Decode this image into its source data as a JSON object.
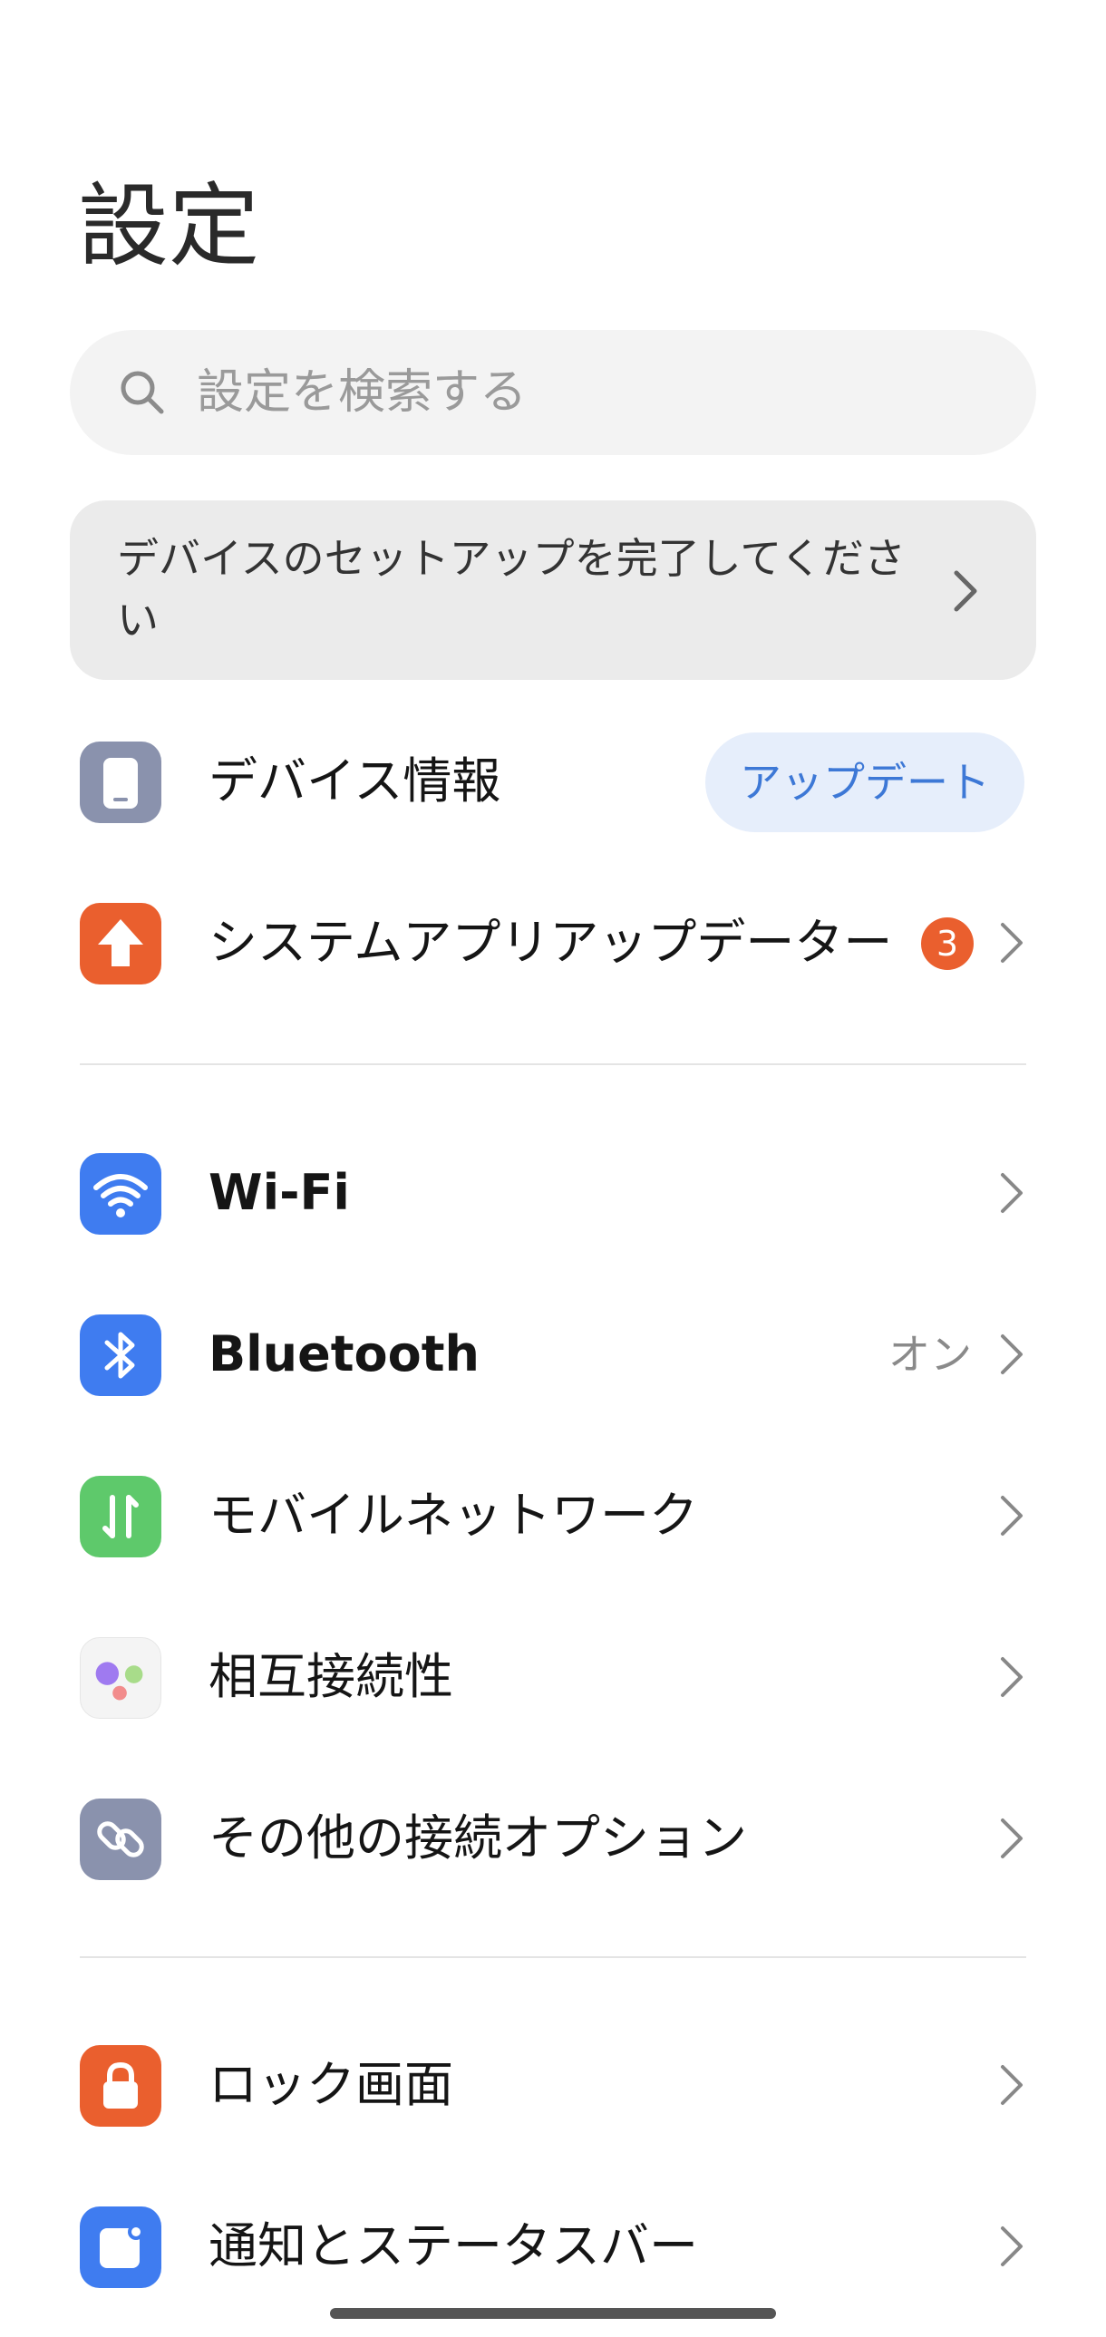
{
  "page": {
    "title": "設定"
  },
  "search": {
    "placeholder": "設定を検索する"
  },
  "banner": {
    "text": "デバイスのセットアップを完了してください"
  },
  "section1": {
    "device_info": {
      "label": "デバイス情報",
      "button": "アップデート",
      "icon": "phone-icon",
      "color": "#8a92ad"
    },
    "system_updater": {
      "label": "システムアプリアップデーター",
      "badge": "3",
      "icon": "arrow-up-icon",
      "color": "#ea5f2e"
    }
  },
  "section2": {
    "wifi": {
      "label": "Wi-Fi",
      "icon": "wifi-icon",
      "color": "#3f7cf0"
    },
    "bluetooth": {
      "label": "Bluetooth",
      "value": "オン",
      "icon": "bluetooth-icon",
      "color": "#3f7cf0"
    },
    "mobile_network": {
      "label": "モバイルネットワーク",
      "icon": "mobile-data-icon",
      "color": "#5ec96b"
    },
    "interconnectivity": {
      "label": "相互接続性",
      "icon": "interconnect-icon"
    },
    "more_connections": {
      "label": "その他の接続オプション",
      "icon": "link-icon",
      "color": "#8a92ad"
    }
  },
  "section3": {
    "lock_screen": {
      "label": "ロック画面",
      "icon": "lock-icon",
      "color": "#ea5f2e"
    },
    "notifications": {
      "label": "通知とステータスバー",
      "icon": "notification-icon",
      "color": "#3f7cf0"
    }
  }
}
